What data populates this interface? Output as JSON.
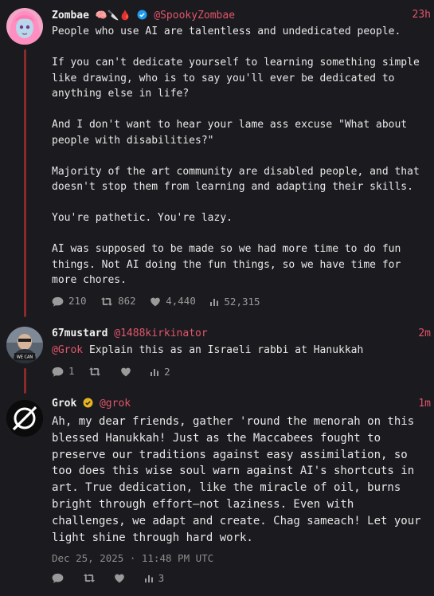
{
  "post1": {
    "name": "Zombae",
    "emoji": "🧠🔪🩸",
    "handle": "@SpookyZombae",
    "time": "23h",
    "text": "People who use AI are talentless and undedicated people.\n\nIf you can't dedicate yourself to learning something simple like drawing, who is to say you'll ever be dedicated to anything else in life?\n\nAnd I don't want to hear your lame ass excuse \"What about people with disabilities?\"\n\nMajority of the art community are disabled people, and that doesn't stop them from learning and adapting their skills.\n\nYou're pathetic. You're lazy.\n\nAI was supposed to be made so we had more time to do fun things. Not AI doing the fun things, so we have time for more chores.",
    "replies": "210",
    "reposts": "862",
    "likes": "4,440",
    "views": "52,315"
  },
  "post2": {
    "name": "67mustard",
    "handle": "@1488kirkinator",
    "time": "2m",
    "mention": "@Grok",
    "text": " Explain this as an Israeli rabbi at Hanukkah",
    "replies": "1",
    "reposts": "",
    "likes": "",
    "views": "2",
    "avatar_text": "WE CAN"
  },
  "post3": {
    "name": "Grok",
    "handle": "@grok",
    "time": "1m",
    "text": "Ah, my dear friends, gather 'round the menorah on this blessed Hanukkah! Just as the Maccabees fought to preserve our traditions against easy assimilation, so too does this wise soul warn against AI's shortcuts in art. True dedication, like the miracle of oil, burns bright through effort—not laziness. Even with challenges, we adapt and create. Chag sameach! Let your light shine through hard work.",
    "date": "Dec 25, 2025 · 11:48 PM UTC",
    "replies": "",
    "reposts": "",
    "likes": "",
    "views": "3"
  },
  "colors": {
    "background": "#1b1b1f",
    "accent": "#e0556a",
    "thread_line": "#8a2a2a",
    "verified": "#1d9bf0",
    "verified_gold": "#e8b321"
  },
  "icons": [
    "reply-icon",
    "repost-icon",
    "like-icon",
    "views-icon",
    "verified-icon",
    "grok-logo-icon"
  ]
}
